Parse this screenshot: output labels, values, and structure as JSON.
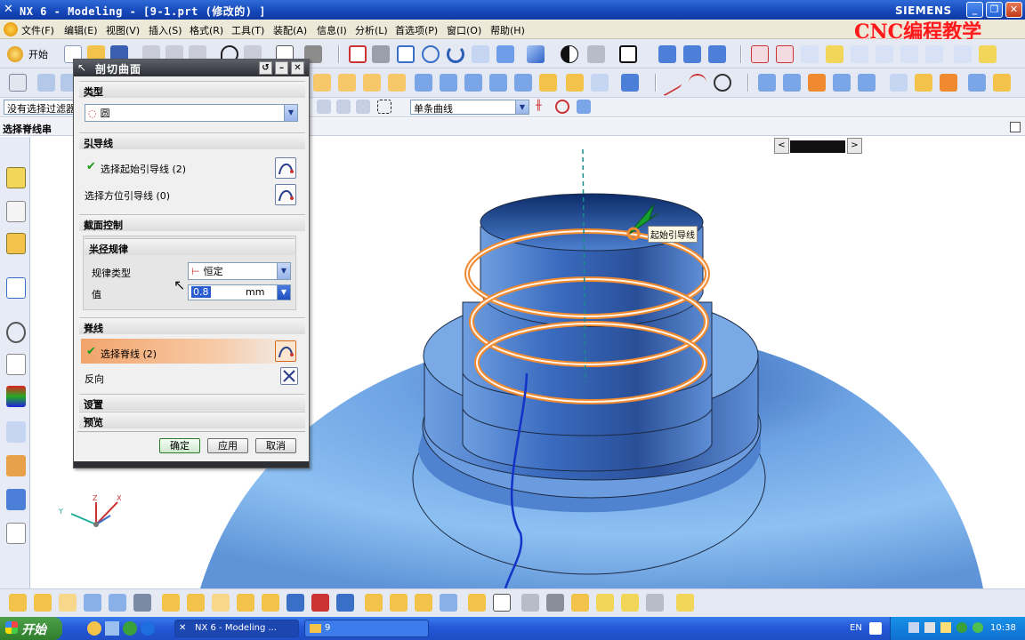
{
  "window": {
    "title": "NX 6 - Modeling - [9-1.prt  (修改的) ]",
    "brand": "SIEMENS",
    "watermark": "CNC编程教学"
  },
  "menubar": {
    "items": [
      {
        "label": "开始"
      },
      {
        "label": "文件(F)"
      },
      {
        "label": "编辑(E)"
      },
      {
        "label": "视图(V)"
      },
      {
        "label": "插入(S)"
      },
      {
        "label": "格式(R)"
      },
      {
        "label": "工具(T)"
      },
      {
        "label": "装配(A)"
      },
      {
        "label": "信息(I)"
      },
      {
        "label": "分析(L)"
      },
      {
        "label": "首选项(P)"
      },
      {
        "label": "窗口(O)"
      },
      {
        "label": "帮助(H)"
      }
    ]
  },
  "selection_bar": {
    "filter": "没有选择过滤器",
    "curve_rule": "单条曲线"
  },
  "cue_line": "选择脊线串",
  "dialog": {
    "title": "剖切曲面",
    "type_group": {
      "header": "类型",
      "value": "圆"
    },
    "guide_group": {
      "header": "引导线",
      "start_guide": "选择起始引导线 (2)",
      "orient_guide": "选择方位引导线 (0)"
    },
    "section_group": {
      "header": "截面控制"
    },
    "radius_group": {
      "header": "半径规律",
      "law_type_label": "规律类型",
      "law_type_value": "恒定",
      "value_label": "值",
      "value": "0.8",
      "unit": "mm"
    },
    "spine_group": {
      "header": "脊线",
      "select_spine": "选择脊线 (2)",
      "reverse": "反向"
    },
    "settings_header": "设置",
    "preview_header": "预览",
    "buttons": {
      "ok": "确定",
      "apply": "应用",
      "cancel": "取消"
    }
  },
  "graphics": {
    "tag_label": "起始引导线"
  },
  "taskbar": {
    "start": "开始",
    "tasks": [
      {
        "label": "NX 6 - Modeling ..."
      },
      {
        "label": "9"
      }
    ],
    "lang": "EN",
    "clock": "10:38"
  },
  "colors": {
    "title_bar": "#1546b8",
    "highlight_orange": "#f08a30",
    "model_blue": "#5f95d8",
    "watermark_red": "#ff1a1a"
  }
}
